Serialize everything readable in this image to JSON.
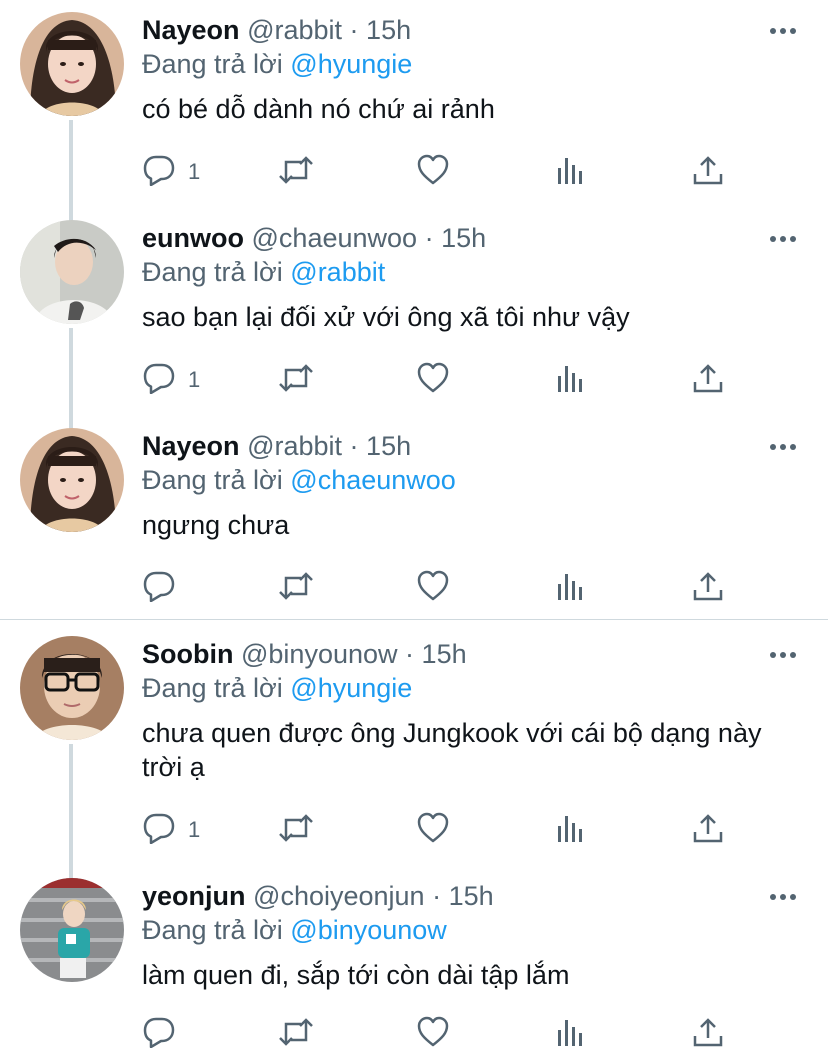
{
  "tweets": [
    {
      "name": "Nayeon",
      "handle": "@rabbit",
      "dot": "·",
      "time": "15h",
      "replying_prefix": "Đang trả lời",
      "replying_to": "@hyungie",
      "text": "có bé dỗ dành nó chứ ai rảnh",
      "reply_count": "1",
      "avatar_icon": "profile-photo-nayeon"
    },
    {
      "name": "eunwoo",
      "handle": "@chaeunwoo",
      "dot": "·",
      "time": "15h",
      "replying_prefix": "Đang trả lời",
      "replying_to": "@rabbit",
      "text": "sao bạn lại đối xử với ông xã tôi như vậy",
      "reply_count": "1",
      "avatar_icon": "profile-photo-eunwoo"
    },
    {
      "name": "Nayeon",
      "handle": "@rabbit",
      "dot": "·",
      "time": "15h",
      "replying_prefix": "Đang trả lời",
      "replying_to": "@chaeunwoo",
      "text": "ngưng chưa",
      "reply_count": "",
      "avatar_icon": "profile-photo-nayeon"
    },
    {
      "name": "Soobin",
      "handle": "@binyounow",
      "dot": "·",
      "time": "15h",
      "replying_prefix": "Đang trả lời",
      "replying_to": "@hyungie",
      "text": "chưa quen được ông Jungkook với cái bộ dạng này trời ạ",
      "reply_count": "1",
      "avatar_icon": "profile-photo-soobin"
    },
    {
      "name": "yeonjun",
      "handle": "@choiyeonjun",
      "dot": "·",
      "time": "15h",
      "replying_prefix": "Đang trả lời",
      "replying_to": "@binyounow",
      "text": "làm quen đi, sắp tới còn dài tập lắm",
      "reply_count": "",
      "avatar_icon": "profile-photo-yeonjun"
    }
  ],
  "icons": {
    "reply": "reply-icon",
    "retweet": "retweet-icon",
    "like": "heart-icon",
    "views": "analytics-icon",
    "share": "share-icon",
    "more": "more-icon"
  },
  "colors": {
    "text": "#0f1419",
    "secondary": "#536471",
    "accent": "#1d9bf0",
    "thread_line": "#cfd9de"
  }
}
